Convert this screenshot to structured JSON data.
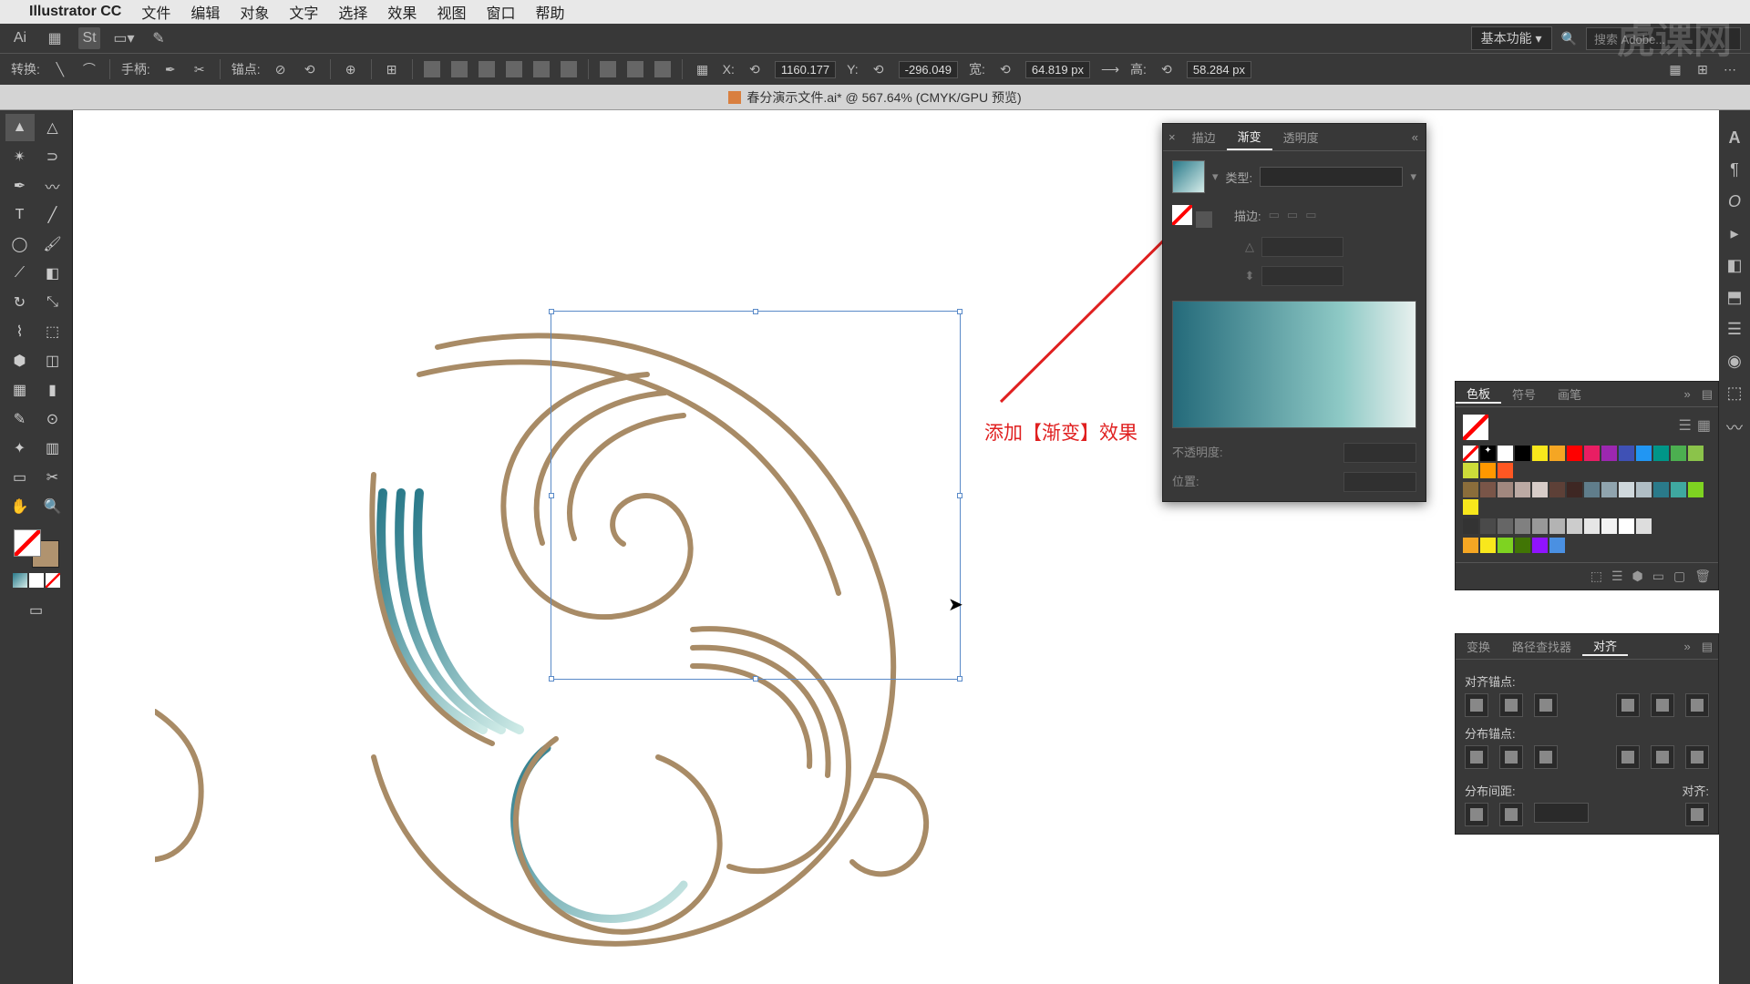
{
  "menubar": {
    "app": "Illustrator CC",
    "items": [
      "文件",
      "编辑",
      "对象",
      "文字",
      "选择",
      "效果",
      "视图",
      "窗口",
      "帮助"
    ]
  },
  "optbar": {
    "workspace": "基本功能",
    "search_placeholder": "搜索 Adobe..."
  },
  "ctrlbar": {
    "transform": "转换:",
    "handle": "手柄:",
    "anchor": "锚点:",
    "x_label": "X:",
    "x_val": "1160.177",
    "y_label": "Y:",
    "y_val": "-296.049",
    "w_label": "宽:",
    "w_val": "64.819 px",
    "h_label": "高:",
    "h_val": "58.284 px"
  },
  "document": {
    "title": "春分演示文件.ai* @ 567.64% (CMYK/GPU 预览)"
  },
  "annotation": {
    "text": "添加【渐变】效果"
  },
  "gradient_panel": {
    "tabs": [
      "描边",
      "渐变",
      "透明度"
    ],
    "active_tab": 1,
    "type_label": "类型:",
    "stroke_label": "描边:",
    "opacity_label": "不透明度:",
    "location_label": "位置:"
  },
  "swatches_panel": {
    "tabs": [
      "色板",
      "符号",
      "画笔"
    ],
    "active_tab": 0,
    "colors_row1": [
      "#ffffff",
      "#000000",
      "#f8e71c",
      "#f5a623",
      "#ff0000",
      "#e91e63",
      "#9c27b0",
      "#3f51b5",
      "#2196f3",
      "#009688",
      "#4caf50",
      "#8bc34a",
      "#cddc39",
      "#ff9800",
      "#ff5722"
    ],
    "colors_row2": [
      "#8a6d3b",
      "#795548",
      "#a1887f",
      "#bcaaa4",
      "#d7ccc8",
      "#5d4037",
      "#3e2723",
      "#607d8b",
      "#90a4ae",
      "#cfd8dc",
      "#b0bec5",
      "#2a7a8a",
      "#3fa8a0",
      "#7ed321",
      "#f8e71c"
    ],
    "colors_row3": [
      "#333333",
      "#4a4a4a",
      "#666666",
      "#808080",
      "#999999",
      "#b3b3b3",
      "#cccccc",
      "#e6e6e6",
      "#f2f2f2",
      "#ffffff",
      "#dddddd"
    ],
    "colors_row4": [
      "#f5a623",
      "#f8e71c",
      "#7ed321",
      "#417505",
      "#9013fe",
      "#4a90e2"
    ]
  },
  "align_panel": {
    "tabs": [
      "变换",
      "路径查找器",
      "对齐"
    ],
    "active_tab": 2,
    "sec1": "对齐锚点:",
    "sec2": "分布锚点:",
    "sec3": "分布间距:",
    "sec4": "对齐:"
  },
  "watermark": "虎课网"
}
